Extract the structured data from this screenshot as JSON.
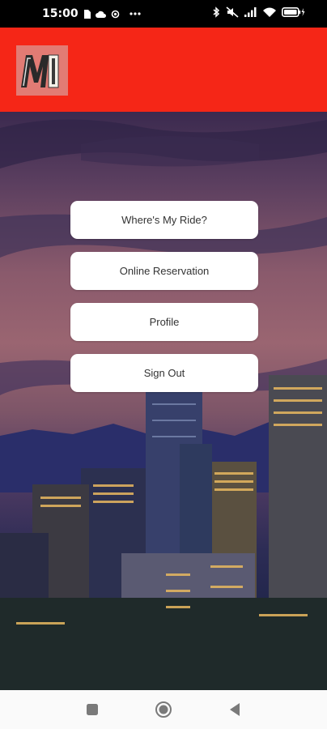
{
  "status_bar": {
    "time": "15:00",
    "icons": [
      "sim-card-icon",
      "cloud-icon",
      "location-icon",
      "more-dots-icon",
      "bluetooth-icon",
      "mute-icon",
      "signal-icon",
      "wifi-icon",
      "battery-icon"
    ]
  },
  "header": {
    "logo_text": "MI",
    "background": "#f52617"
  },
  "menu": {
    "buttons": [
      {
        "label": "Where's  My Ride?"
      },
      {
        "label": "Online Reservation"
      },
      {
        "label": "Profile"
      },
      {
        "label": "Sign Out"
      }
    ]
  },
  "nav_bar": {
    "icons": [
      "recents-square-icon",
      "home-circle-icon",
      "back-triangle-icon"
    ]
  }
}
